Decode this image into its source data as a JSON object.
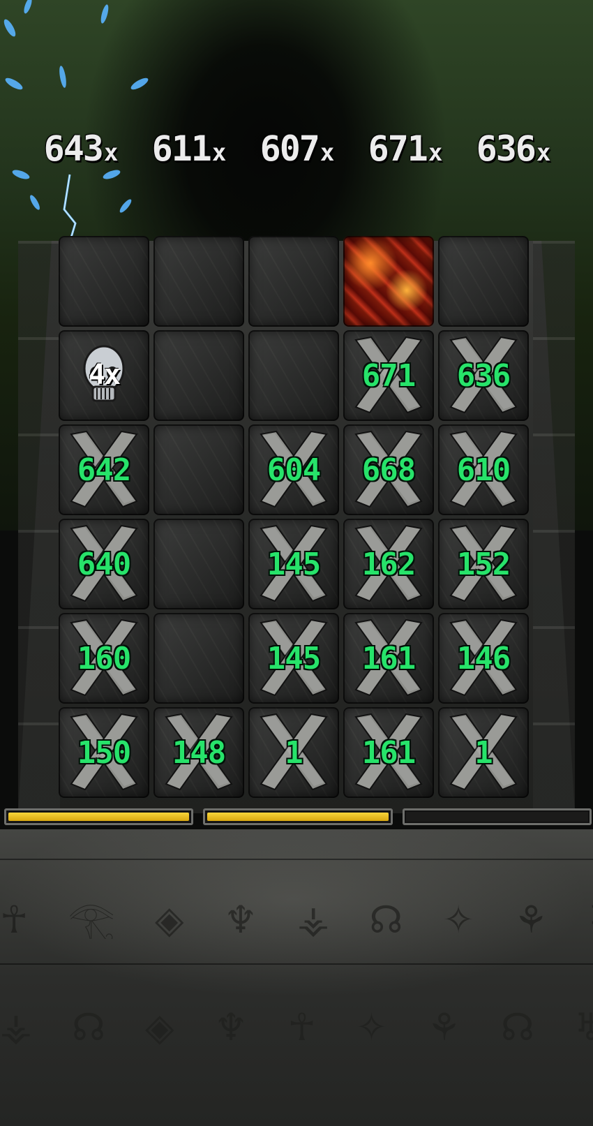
{
  "multipliers": [
    {
      "value": "643",
      "suffix": "x"
    },
    {
      "value": "611",
      "suffix": "x"
    },
    {
      "value": "607",
      "suffix": "x"
    },
    {
      "value": "671",
      "suffix": "x"
    },
    {
      "value": "636",
      "suffix": "x"
    }
  ],
  "skull_badge": "4x",
  "grid": [
    [
      {
        "type": "stone",
        "value": ""
      },
      {
        "type": "stone",
        "value": ""
      },
      {
        "type": "stone",
        "value": ""
      },
      {
        "type": "lava",
        "value": ""
      },
      {
        "type": "stone",
        "value": ""
      }
    ],
    [
      {
        "type": "skull",
        "value": "4x"
      },
      {
        "type": "stone",
        "value": ""
      },
      {
        "type": "stone",
        "value": ""
      },
      {
        "type": "x",
        "value": "671"
      },
      {
        "type": "x",
        "value": "636"
      }
    ],
    [
      {
        "type": "x",
        "value": "642"
      },
      {
        "type": "stone",
        "value": ""
      },
      {
        "type": "x",
        "value": "604"
      },
      {
        "type": "x",
        "value": "668"
      },
      {
        "type": "x",
        "value": "610"
      }
    ],
    [
      {
        "type": "x",
        "value": "640"
      },
      {
        "type": "stone",
        "value": ""
      },
      {
        "type": "x",
        "value": "145"
      },
      {
        "type": "x",
        "value": "162"
      },
      {
        "type": "x",
        "value": "152"
      }
    ],
    [
      {
        "type": "x",
        "value": "160"
      },
      {
        "type": "stone",
        "value": ""
      },
      {
        "type": "x",
        "value": "145"
      },
      {
        "type": "x",
        "value": "161"
      },
      {
        "type": "x",
        "value": "146"
      }
    ],
    [
      {
        "type": "x",
        "value": "150"
      },
      {
        "type": "x",
        "value": "148"
      },
      {
        "type": "x",
        "value": "1"
      },
      {
        "type": "x",
        "value": "161"
      },
      {
        "type": "x",
        "value": "1"
      }
    ]
  ],
  "progress_bars": [
    1.0,
    1.0,
    0.0
  ],
  "colors": {
    "value_text": "#27e36a",
    "bar_fill": "#f2c620",
    "lava": "#c0301a",
    "spark": "#4aa8ff"
  },
  "icons": {
    "skull": "skull-icon",
    "crossed_bones": "x-mark-icon",
    "lightning": "lightning-icon"
  }
}
